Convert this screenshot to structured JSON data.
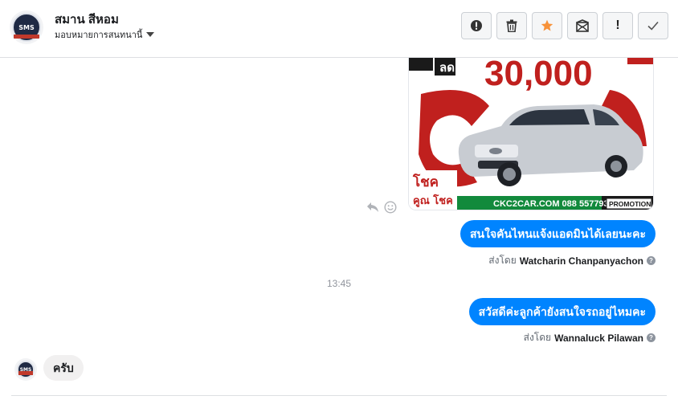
{
  "header": {
    "contact_name": "สมาน สีหอม",
    "assign_label": "มอบหมายการสนทนานี้",
    "avatar_text": "SMS",
    "toolbar": [
      {
        "icon": "alert-circle-icon",
        "label": "Mark as spam"
      },
      {
        "icon": "trash-icon",
        "label": "Delete"
      },
      {
        "icon": "star-icon",
        "label": "Star"
      },
      {
        "icon": "mark-unread-icon",
        "label": "Mark as unread"
      },
      {
        "icon": "exclamation-icon",
        "label": "Follow up"
      },
      {
        "icon": "check-icon",
        "label": "Mark as done"
      }
    ]
  },
  "promo_image": {
    "price_text": "30,000",
    "tag_text": "ลด",
    "website": "CKC2CAR.COM 088 5577932",
    "badge": "PROMOTION",
    "slogan_top": "โชค",
    "slogan_bottom": "คูณ โชค"
  },
  "messages": [
    {
      "direction": "out",
      "text": "สนใจคันไหนแจ้งแอดมินได้เลยนะคะ",
      "sent_by_prefix": "ส่งโดย",
      "sender": "Watcharin Chanpanyachon"
    },
    {
      "direction": "out",
      "text": "สวัสดีค่ะลูกค้ายังสนใจรถอยู่ไหมคะ",
      "sent_by_prefix": "ส่งโดย",
      "sender": "Wannaluck Pilawan"
    },
    {
      "direction": "in",
      "text": "ครับ"
    }
  ],
  "timestamp": "13:45",
  "colors": {
    "accent_blue": "#0084ff",
    "star_orange": "#f7923a",
    "promo_red": "#c0201e"
  }
}
